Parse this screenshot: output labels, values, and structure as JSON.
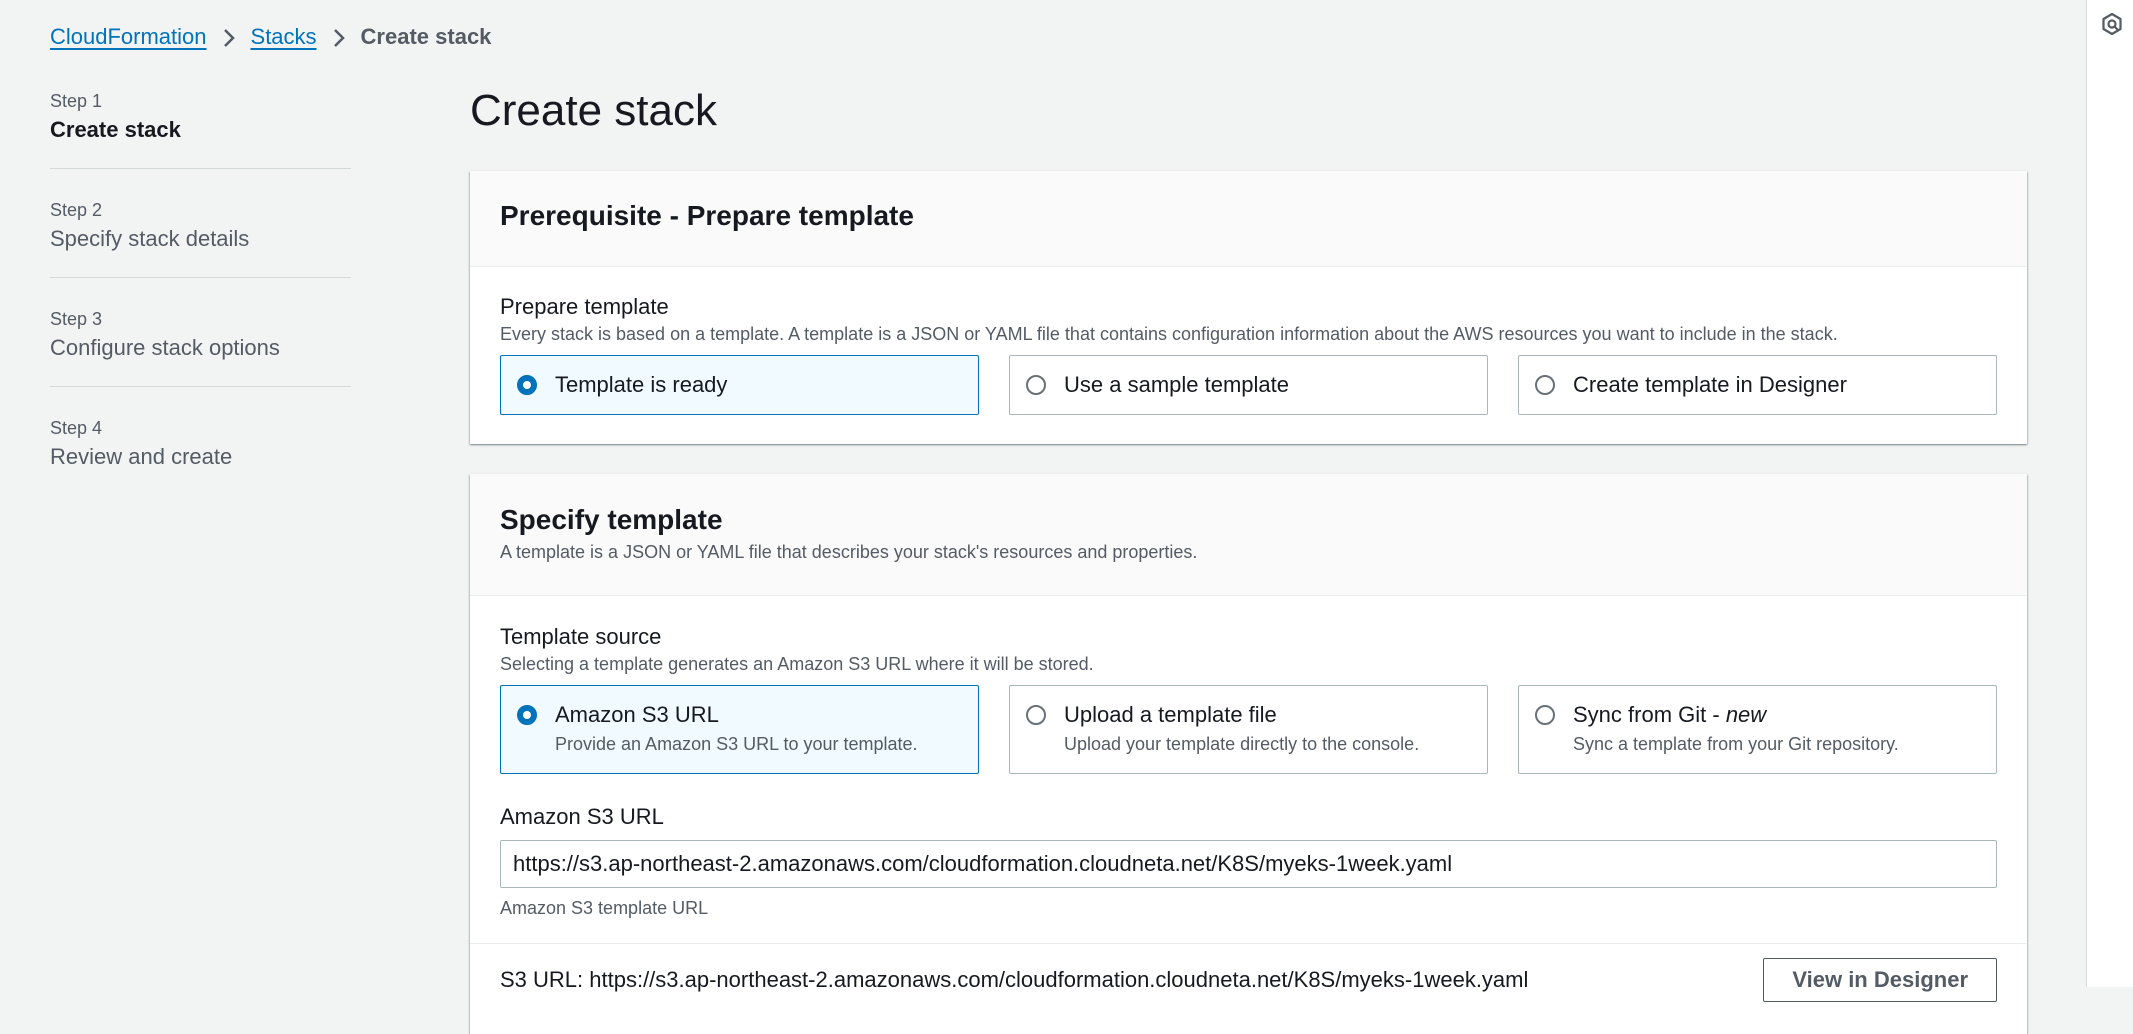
{
  "breadcrumb": {
    "items": [
      "CloudFormation",
      "Stacks"
    ],
    "current": "Create stack"
  },
  "steps": [
    {
      "num": "Step 1",
      "title": "Create stack"
    },
    {
      "num": "Step 2",
      "title": "Specify stack details"
    },
    {
      "num": "Step 3",
      "title": "Configure stack options"
    },
    {
      "num": "Step 4",
      "title": "Review and create"
    }
  ],
  "page_title": "Create stack",
  "prerequisite": {
    "header": "Prerequisite - Prepare template",
    "label": "Prepare template",
    "description": "Every stack is based on a template. A template is a JSON or YAML file that contains configuration information about the AWS resources you want to include in the stack.",
    "options": [
      {
        "label": "Template is ready",
        "selected": true
      },
      {
        "label": "Use a sample template",
        "selected": false
      },
      {
        "label": "Create template in Designer",
        "selected": false
      }
    ]
  },
  "specify": {
    "header": "Specify template",
    "header_desc": "A template is a JSON or YAML file that describes your stack's resources and properties.",
    "source_label": "Template source",
    "source_desc": "Selecting a template generates an Amazon S3 URL where it will be stored.",
    "sources": [
      {
        "label": "Amazon S3 URL",
        "desc": "Provide an Amazon S3 URL to your template.",
        "selected": true
      },
      {
        "label": "Upload a template file",
        "desc": "Upload your template directly to the console.",
        "selected": false
      },
      {
        "label": "Sync from Git",
        "label_suffix": "new",
        "desc": "Sync a template from your Git repository.",
        "selected": false
      }
    ],
    "s3_label": "Amazon S3 URL",
    "s3_value": "https://s3.ap-northeast-2.amazonaws.com/cloudformation.cloudneta.net/K8S/myeks-1week.yaml",
    "s3_hint": "Amazon S3 template URL",
    "s3_url_line": "S3 URL: https://s3.ap-northeast-2.amazonaws.com/cloudformation.cloudneta.net/K8S/myeks-1week.yaml",
    "designer_button": "View in Designer"
  },
  "colors": {
    "link": "#0073bb",
    "selected_border": "#0073bb",
    "selected_bg": "#f1faff",
    "page_bg": "#f2f3f3"
  },
  "icons": {
    "breadcrumb_separator": "chevron-right-icon",
    "right_rail": "feedback-icon"
  }
}
